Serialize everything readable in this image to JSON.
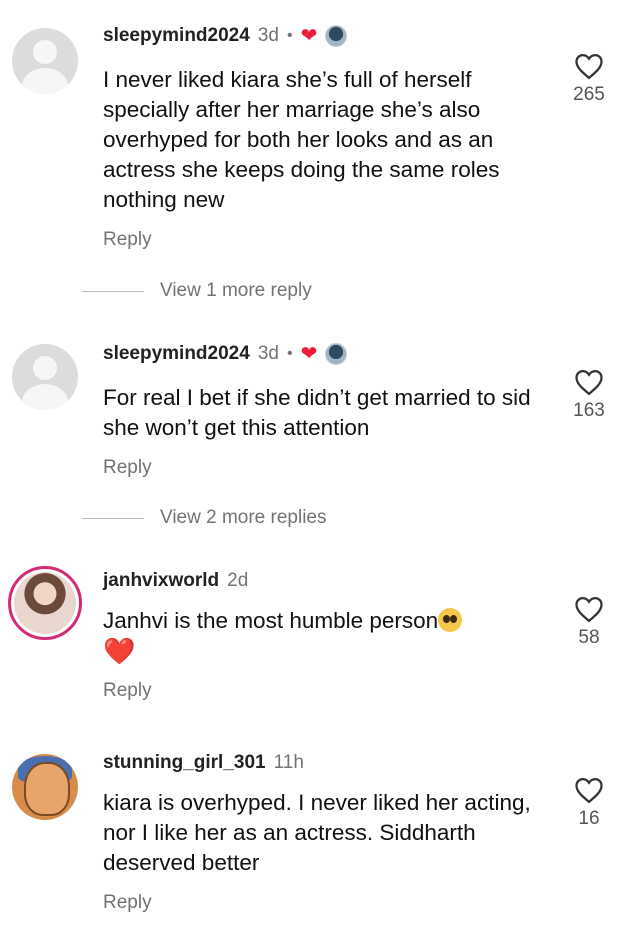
{
  "comments": [
    {
      "username": "sleepymind2024",
      "time": "3d",
      "dot": "•",
      "text": "I never liked kiara she’s full of herself specially after her marriage she’s also overhyped for both her looks and as an actress she keeps doing the same roles nothing new",
      "reply_label": "Reply",
      "likes": "265",
      "view_more": "View 1 more reply",
      "avatar": "default-avatar",
      "creator_liked": true
    },
    {
      "username": "sleepymind2024",
      "time": "3d",
      "dot": "•",
      "text": "For real I bet if she didn’t get married to sid she won’t get this attention",
      "reply_label": "Reply",
      "likes": "163",
      "view_more": "View 2 more replies",
      "avatar": "default-avatar",
      "creator_liked": true
    },
    {
      "username": "janhvixworld",
      "time": "2d",
      "text": "Janhvi is the most humble person",
      "emoji_1": "pleading-face",
      "emoji_2": "❤️",
      "reply_label": "Reply",
      "likes": "58",
      "avatar": "story-ring-avatar"
    },
    {
      "username": "stunning_girl_301",
      "time": "11h",
      "text": "kiara is overhyped. I never liked her acting, nor I like her as an actress. Siddharth deserved better",
      "reply_label": "Reply",
      "likes": "16",
      "avatar": "cartoon-avatar"
    }
  ],
  "colors": {
    "muted": "#737373",
    "heart_red": "#ed1c3a"
  }
}
